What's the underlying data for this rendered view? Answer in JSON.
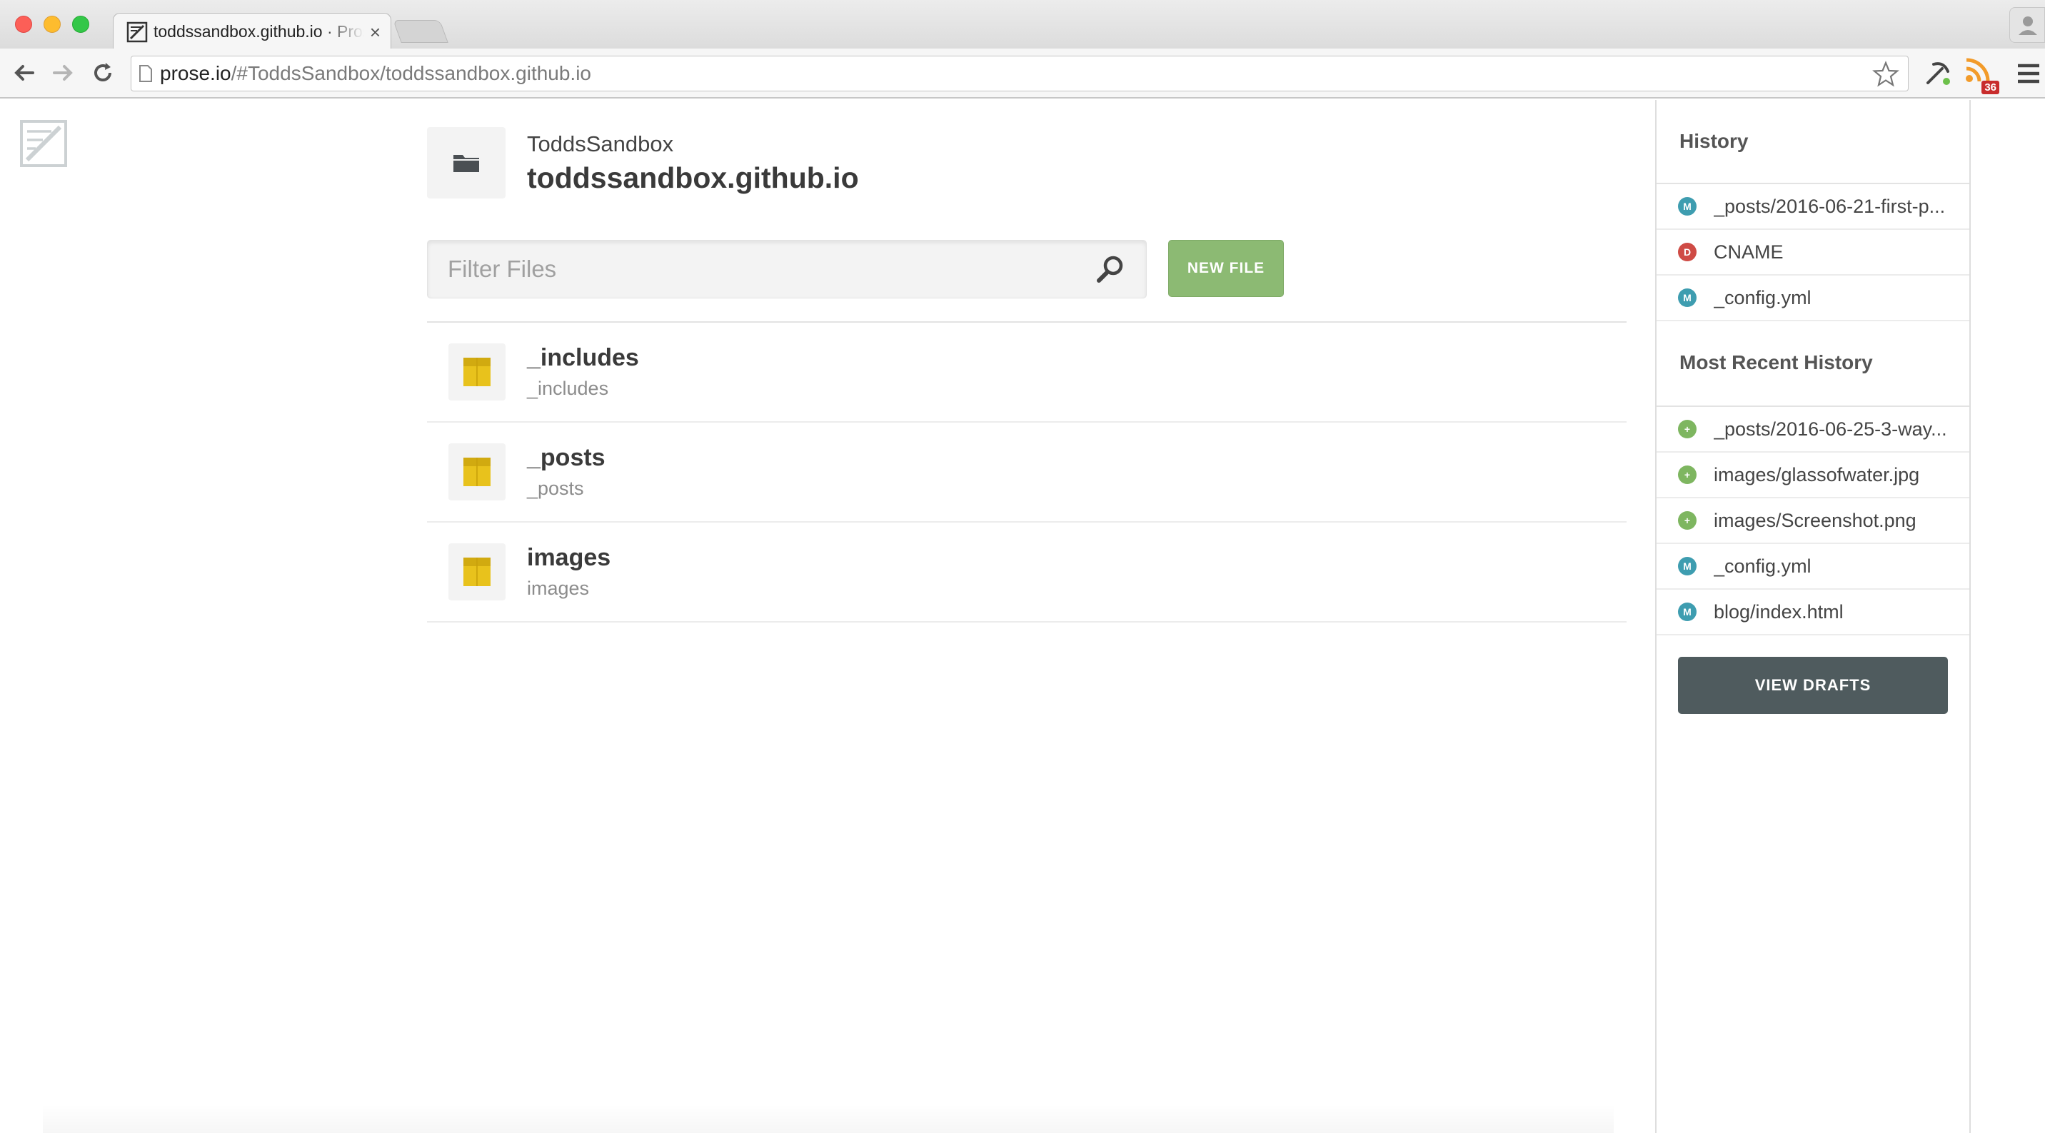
{
  "browser": {
    "tab_title": "toddssandbox.github.io · Prose",
    "tab_close": "×",
    "url_host": "prose.io",
    "url_path": "/#ToddsSandbox/toddssandbox.github.io",
    "rss_badge_count": "36"
  },
  "repo": {
    "owner": "ToddsSandbox",
    "name": "toddssandbox.github.io"
  },
  "filter": {
    "placeholder": "Filter Files",
    "value": ""
  },
  "new_file_label": "NEW FILE",
  "files": [
    {
      "name": "_includes",
      "path": "_includes"
    },
    {
      "name": "_posts",
      "path": "_posts"
    },
    {
      "name": "images",
      "path": "images"
    }
  ],
  "sidebar": {
    "history_heading": "History",
    "history": [
      {
        "badge": "M",
        "kind": "modified",
        "label": "_posts/2016-06-21-first-p..."
      },
      {
        "badge": "D",
        "kind": "deleted",
        "label": "CNAME"
      },
      {
        "badge": "M",
        "kind": "modified",
        "label": "_config.yml"
      }
    ],
    "recent_heading": "Most Recent History",
    "recent": [
      {
        "badge": "+",
        "kind": "added",
        "label": "_posts/2016-06-25-3-way..."
      },
      {
        "badge": "+",
        "kind": "added",
        "label": "images/glassofwater.jpg"
      },
      {
        "badge": "+",
        "kind": "added",
        "label": "images/Screenshot.png"
      },
      {
        "badge": "M",
        "kind": "modified",
        "label": "_config.yml"
      },
      {
        "badge": "M",
        "kind": "modified",
        "label": "blog/index.html"
      }
    ],
    "view_drafts_label": "VIEW DRAFTS"
  },
  "colors": {
    "new_file_green": "#8cba73",
    "badge_modified": "#3e9db0",
    "badge_deleted": "#cf4b45",
    "badge_added": "#7eb660",
    "folder_yellow": "#e8c21c",
    "drafts_button": "#4f5b5e"
  },
  "icons": {
    "tab": "prose-logo-icon",
    "repo": "folder-icon",
    "file": "folder-icon",
    "filter": "search-icon"
  }
}
